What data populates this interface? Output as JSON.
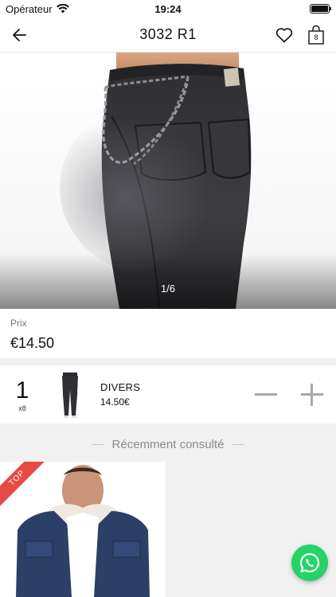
{
  "status_bar": {
    "carrier": "Opérateur",
    "time": "19:24"
  },
  "nav": {
    "title": "3032 R1",
    "cart_count": "8"
  },
  "gallery": {
    "counter": "1/6"
  },
  "price": {
    "label": "Prix",
    "value": "€14.50"
  },
  "cart_line": {
    "quantity": "1",
    "quantity_sub": "x8",
    "name": "DIVERS",
    "price": "14.50€"
  },
  "recent": {
    "title": "Récemment consulté",
    "items": [
      {
        "badge": "TOP"
      }
    ]
  },
  "colors": {
    "accent_green": "#25d366",
    "ribbon_red": "#e74a44",
    "denim_dark": "#2b2b2e",
    "denim_blue": "#2c3f66"
  }
}
